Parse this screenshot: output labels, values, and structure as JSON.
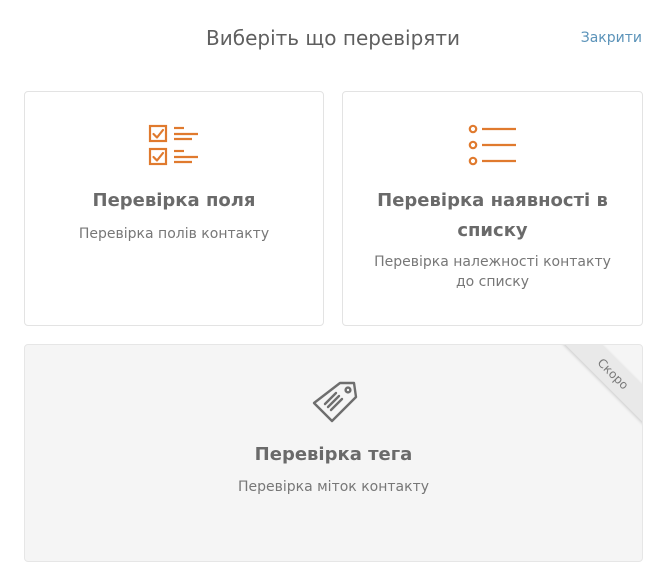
{
  "header": {
    "title": "Виберіть що перевіряти",
    "close_label": "Закрити"
  },
  "cards": {
    "field": {
      "icon": "checklist-icon",
      "title": "Перевірка поля",
      "description": "Перевірка полів контакту"
    },
    "list": {
      "icon": "bullet-list-icon",
      "title": "Перевірка наявності в списку",
      "description": "Перевірка належності контакту до списку"
    },
    "tag": {
      "icon": "tag-icon",
      "title": "Перевірка тега",
      "description": "Перевірка міток контакту",
      "badge": "Скоро"
    }
  },
  "colors": {
    "accent_orange": "#e07a2e",
    "link_blue": "#5b93b9",
    "disabled_bg": "#f5f5f5"
  }
}
